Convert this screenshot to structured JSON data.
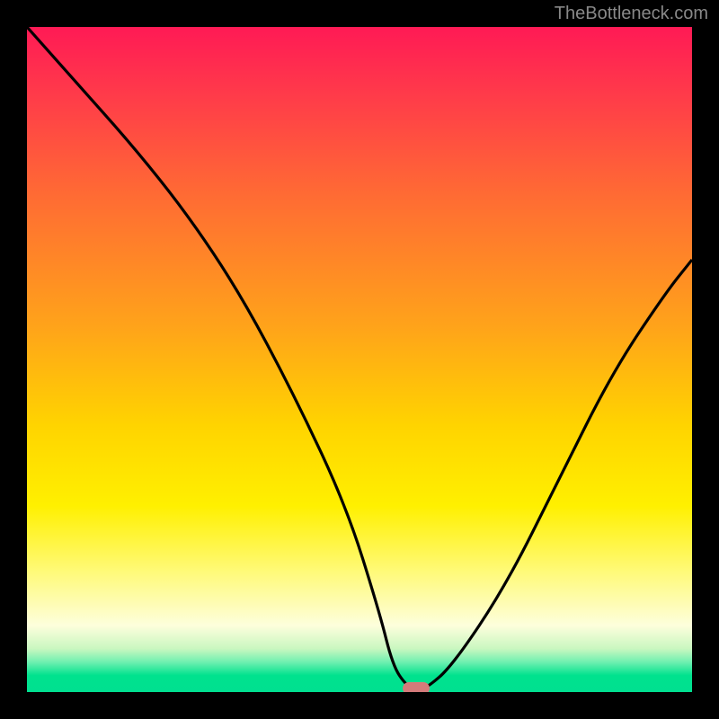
{
  "watermark": "TheBottleneck.com",
  "chart_data": {
    "type": "line",
    "title": "",
    "xlabel": "",
    "ylabel": "",
    "xlim": [
      0,
      100
    ],
    "ylim": [
      0,
      100
    ],
    "grid": false,
    "legend": false,
    "series": [
      {
        "name": "bottleneck-curve",
        "x": [
          0,
          8,
          16,
          24,
          32,
          40,
          48,
          53,
          55,
          57,
          58.5,
          60,
          64,
          72,
          80,
          88,
          96,
          100
        ],
        "y": [
          100,
          91,
          82,
          72,
          60,
          45,
          28,
          12,
          4,
          1,
          0.5,
          0.5,
          4,
          16,
          32,
          48,
          60,
          65
        ]
      }
    ],
    "marker": {
      "x": 58.5,
      "y": 0.6,
      "shape": "pill",
      "color": "#d47a7a"
    },
    "gradient_stops": [
      {
        "pos": 0.0,
        "color": "#ff1a55"
      },
      {
        "pos": 0.25,
        "color": "#ff6a34"
      },
      {
        "pos": 0.6,
        "color": "#ffd400"
      },
      {
        "pos": 0.82,
        "color": "#fffa7a"
      },
      {
        "pos": 0.95,
        "color": "#6ef0b0"
      },
      {
        "pos": 1.0,
        "color": "#00e090"
      }
    ]
  }
}
